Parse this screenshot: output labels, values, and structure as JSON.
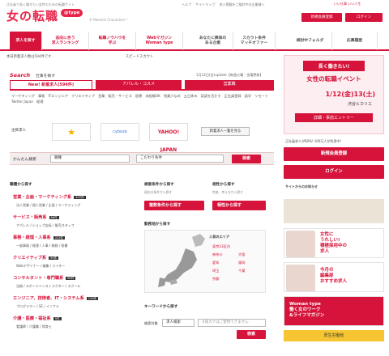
{
  "header": {
    "tagline": "正社員で長く働きたい女性のための転職サイト",
    "logo": "女の転職",
    "logo_type": "@type",
    "moomin": "© Moomin Characters™",
    "top_links": [
      "ヘルプ",
      "サイトマップ",
      "求人掲載をご検討中の企業様へ"
    ],
    "brand": "いい仕事 いい人生",
    "new_member_btn": "新規会員登録",
    "login_btn": "ログイン"
  },
  "nav": [
    {
      "label": "求人を探す",
      "active": true
    },
    {
      "label": "志向に合う\n求人ランキング"
    },
    {
      "label": "転職ノウハウを\n学ぶ"
    },
    {
      "label": "Webマガジン\nWoman type"
    },
    {
      "label": "あなたに興味の\nある企業"
    },
    {
      "label": "スカウト条件\nマッチオファー"
    },
    {
      "label": "検討中フォルダ"
    },
    {
      "label": "応募履歴"
    }
  ],
  "news": [
    "本日新着求人数は594件です",
    "スピードスカウト"
  ],
  "search": {
    "heading": "Search",
    "sub": "仕事を探す",
    "update": "1月12日(金)update【毎週火曜・金曜更新】",
    "tabs": [
      "New! 新着求人(594件)",
      "アパレル・コスメ",
      "営業職"
    ],
    "tags": [
      "マーケティング",
      "事務",
      "ITエンジニア",
      "クリエイティブ",
      "営業",
      "販売・サービス",
      "医療",
      "未経験OK",
      "残業少なめ",
      "土日休み",
      "英語を活かす",
      "正社員登録",
      "語学",
      "リモート",
      "Twitter Japan",
      "経理"
    ],
    "featured_label": "注目求人",
    "corp_logos": [
      "cyboze",
      "YAHOO! JAPAN"
    ],
    "corp_list_btn": "新着求人一覧を見る",
    "kantan_label": "かんたん検索",
    "select1": "職種",
    "select2": "こだわり条件",
    "search_btn": "検索"
  },
  "jobcats": {
    "heading": "職種から探す",
    "items": [
      {
        "label": "営業・企画・マーケティング系",
        "count": "422件",
        "sub": "法人営業 / 個人営業 / 企画 / マーケティング"
      },
      {
        "label": "サービス・販売系",
        "count": "86件",
        "sub": "アパレル / ショップ店長 / 販売スタッフ"
      },
      {
        "label": "事務・経理・人事系",
        "count": "222件",
        "sub": "一般事務 / 経理 / 人事 / 総務 / 秘書"
      },
      {
        "label": "クリエイティブ系",
        "count": "90件",
        "sub": "Webデザイナー / 編集 / ライター"
      },
      {
        "label": "コンサルタント・専門職系",
        "count": "86件",
        "sub": "法務 / スポーツインストラクター / スクール"
      },
      {
        "label": "エンジニア、技術者、IT・システム系",
        "count": "156件",
        "sub": "プログラマー / SE / インフラ"
      },
      {
        "label": "介護・医療・福祉系",
        "count": "5件",
        "sub": "看護師 / 介護職 / 保育士"
      }
    ]
  },
  "middle": {
    "cond_head": "検索条件から探す",
    "cond_sub": "現在の条件から探す",
    "cond_btn": "複数条件から探す",
    "aisho_head": "相性から探す",
    "aisho_sub": "性格、考え方から探す",
    "aisho_btn": "相性から探す",
    "map_head": "勤務地から探す",
    "popular_area": "人気のエリア",
    "areas": [
      "東京23区内",
      "神奈川",
      "大阪",
      "愛知",
      "福岡",
      "埼玉",
      "千葉",
      "京都"
    ],
    "kw_head": "キーワードから探す",
    "kw_label": "検索対象",
    "kw_select": "求人検索",
    "kw_placeholder": "※角カナはご使用できません",
    "kw_btn": "検索"
  },
  "right": {
    "banner_title": "長く働きたい!",
    "banner_sub": "女性の転職イベント",
    "banner_date": "1/12(金)13(土)",
    "banner_venue": "渋谷ヒカリエ",
    "banner_cta": "詳細・事前エントリー",
    "member_text": "正社員求人が60%! 100万人が利用中!",
    "new_member_btn": "新規会員登録",
    "login_btn": "ログイン",
    "sites_text": "サイトからのお知らせ",
    "cards": [
      "女性に\nうれしい!\n積極採用中の\n求人",
      "今月の\n編集部\nおすすめ求人",
      "Woman type\n働く女のワーク\n&ライフマガジン"
    ],
    "promo": "厚生労働省"
  }
}
